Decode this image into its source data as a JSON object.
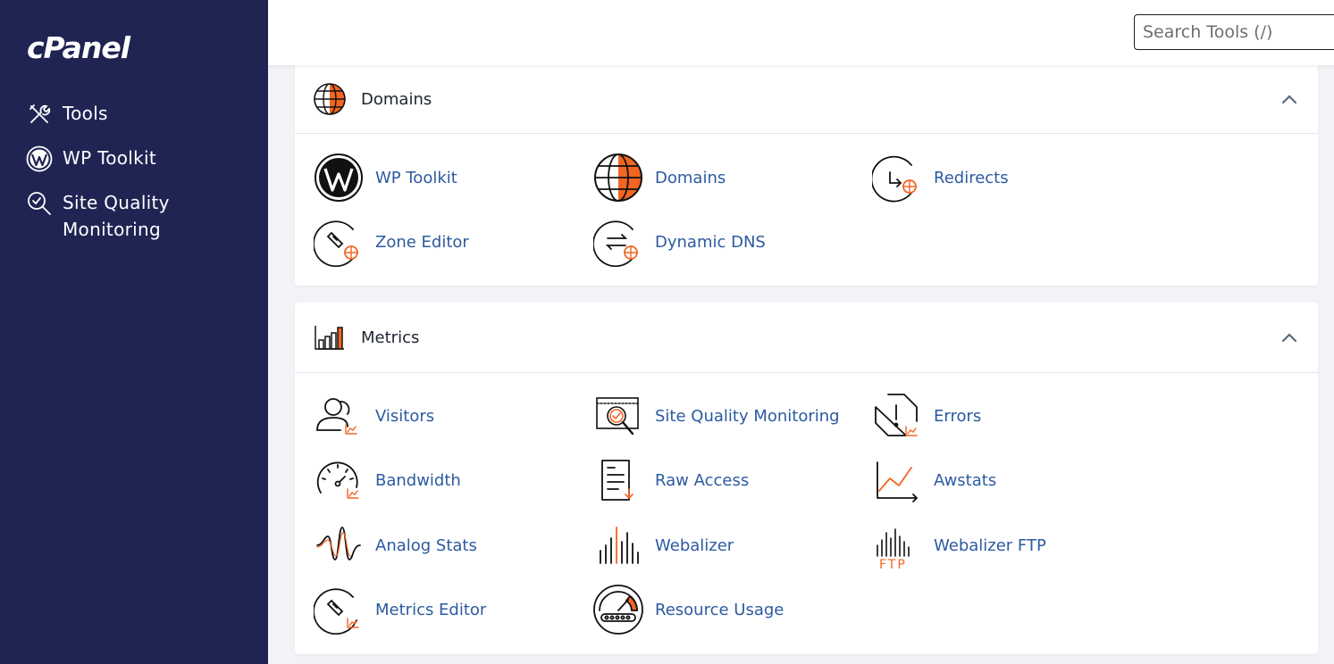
{
  "brand": {
    "logo_text": "cPanel"
  },
  "sidebar": {
    "items": [
      {
        "label": "Tools",
        "icon": "tools-icon"
      },
      {
        "label": "WP Toolkit",
        "icon": "wordpress-icon"
      },
      {
        "label": "Site Quality Monitoring",
        "icon": "site-quality-icon"
      }
    ]
  },
  "header": {
    "search_placeholder": "Search Tools (/)"
  },
  "sections": {
    "domains": {
      "title": "Domains",
      "tools": [
        {
          "label": "WP Toolkit",
          "icon": "wordpress-icon"
        },
        {
          "label": "Domains",
          "icon": "globe-icon"
        },
        {
          "label": "Redirects",
          "icon": "redirect-icon"
        },
        {
          "label": "Zone Editor",
          "icon": "zone-editor-icon"
        },
        {
          "label": "Dynamic DNS",
          "icon": "dynamic-dns-icon"
        }
      ]
    },
    "metrics": {
      "title": "Metrics",
      "tools": [
        {
          "label": "Visitors",
          "icon": "visitors-icon"
        },
        {
          "label": "Site Quality Monitoring",
          "icon": "site-quality-icon"
        },
        {
          "label": "Errors",
          "icon": "errors-icon"
        },
        {
          "label": "Bandwidth",
          "icon": "bandwidth-icon"
        },
        {
          "label": "Raw Access",
          "icon": "raw-access-icon"
        },
        {
          "label": "Awstats",
          "icon": "awstats-icon"
        },
        {
          "label": "Analog Stats",
          "icon": "analog-stats-icon"
        },
        {
          "label": "Webalizer",
          "icon": "webalizer-icon"
        },
        {
          "label": "Webalizer FTP",
          "icon": "webalizer-ftp-icon",
          "icon_text": "FTP"
        },
        {
          "label": "Metrics Editor",
          "icon": "metrics-editor-icon"
        },
        {
          "label": "Resource Usage",
          "icon": "resource-usage-icon"
        }
      ]
    }
  },
  "colors": {
    "sidebar_bg": "#1f2453",
    "accent_orange": "#f26522",
    "link_blue": "#2c5aa0",
    "page_bg": "#f2f3f6"
  }
}
